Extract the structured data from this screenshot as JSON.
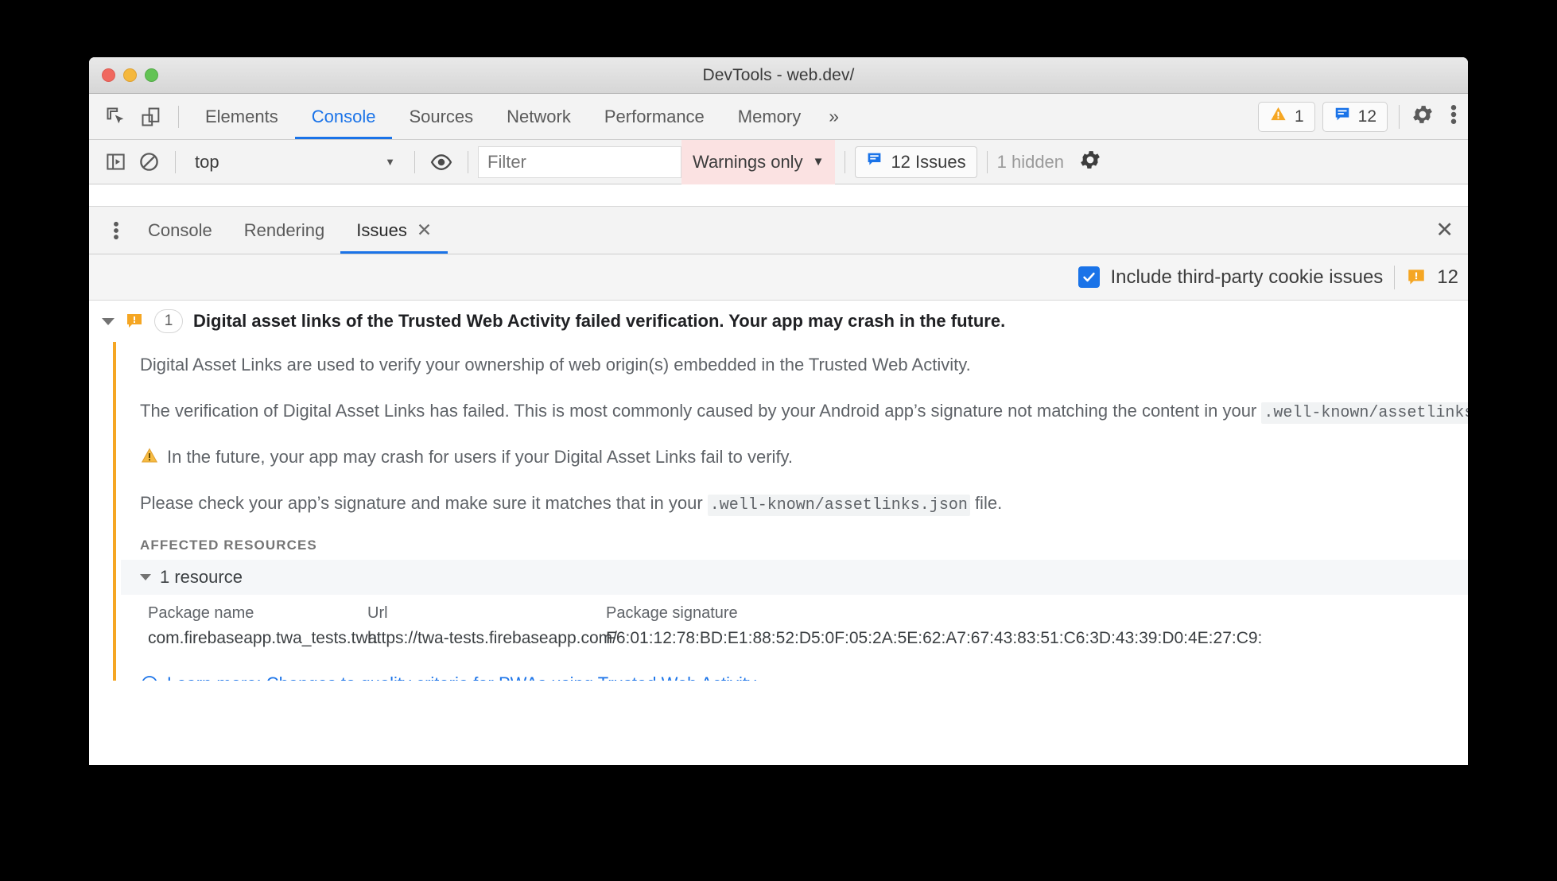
{
  "window": {
    "title": "DevTools - web.dev/",
    "traffic_lights": [
      "close",
      "minimize",
      "maximize"
    ]
  },
  "main_toolbar": {
    "left_icons": [
      "inspect-element-icon",
      "device-toolbar-icon"
    ],
    "tabs": [
      {
        "label": "Elements",
        "active": false
      },
      {
        "label": "Console",
        "active": true
      },
      {
        "label": "Sources",
        "active": false
      },
      {
        "label": "Network",
        "active": false
      },
      {
        "label": "Performance",
        "active": false
      },
      {
        "label": "Memory",
        "active": false
      }
    ],
    "overflow_label": "»",
    "warning_badge": {
      "icon": "warning-triangle-icon",
      "count": "1"
    },
    "issues_badge": {
      "icon": "issue-speech-icon",
      "count": "12"
    },
    "settings_icon": "gear-icon",
    "more_icon": "kebab-menu-icon"
  },
  "console_toolbar": {
    "sidebar_toggle_icon": "console-sidebar-icon",
    "clear_icon": "clear-console-icon",
    "context": "top",
    "context_arrow": "▼",
    "eye_icon": "live-expression-icon",
    "filter_placeholder": "Filter",
    "filter_value": "",
    "level": "Warnings only",
    "level_arrow": "▼",
    "issues_button_label": "12 Issues",
    "hidden_label": "1 hidden",
    "settings_icon": "gear-icon"
  },
  "drawer": {
    "more_icon": "kebab-menu-icon",
    "tabs": [
      {
        "label": "Console",
        "active": false,
        "closable": false
      },
      {
        "label": "Rendering",
        "active": false,
        "closable": false
      },
      {
        "label": "Issues",
        "active": true,
        "closable": true,
        "close_glyph": "✕"
      }
    ],
    "close_drawer_glyph": "✕"
  },
  "issues_panel": {
    "checkbox": {
      "label": "Include third-party cookie issues",
      "checked": true
    },
    "count_icon": "issue-speech-icon",
    "count": "12",
    "issue": {
      "expand_glyph": "▾",
      "icon": "issue-speech-icon",
      "badge": "1",
      "title": "Digital asset links of the Trusted Web Activity failed verification. Your app may crash in the future.",
      "paragraphs": [
        {
          "text": "Digital Asset Links are used to verify your ownership of web origin(s) embedded in the Trusted Web Activity."
        },
        {
          "text_before": "The verification of Digital Asset Links has failed. This is most commonly caused by your Android app’s signature not matching the content in your ",
          "code": ".well-known/assetlinks.json",
          "text_after": ""
        },
        {
          "icon": "warning-triangle-icon",
          "text": "In the future, your app may crash for users if your Digital Asset Links fail to verify."
        },
        {
          "text_before": "Please check your app’s signature and make sure it matches that in your ",
          "code": ".well-known/assetlinks.json",
          "text_after": " file."
        }
      ],
      "affected_resources_label": "AFFECTED RESOURCES",
      "resource_summary": "1 resource",
      "resource_collapse_glyph": "▾",
      "table": {
        "columns": [
          "Package name",
          "Url",
          "Package signature"
        ],
        "rows": [
          [
            "com.firebaseapp.twa_tests.twa",
            "https://twa-tests.firebaseapp.com/",
            "F6:01:12:78:BD:E1:88:52:D5:0F:05:2A:5E:62:A7:67:43:83:51:C6:3D:43:39:D0:4E:27:C9:"
          ]
        ]
      },
      "learn_more": {
        "icon": "external-link-arrow-icon",
        "label": "Learn more: Changes to quality criteria for PWAs using Trusted Web Activity"
      }
    }
  },
  "colors": {
    "accent_blue": "#1a73e8",
    "warning_orange": "#f5a623",
    "level_filter_bg": "#fbe2e2",
    "text_primary": "#3c4043",
    "text_secondary": "#5f6368"
  }
}
